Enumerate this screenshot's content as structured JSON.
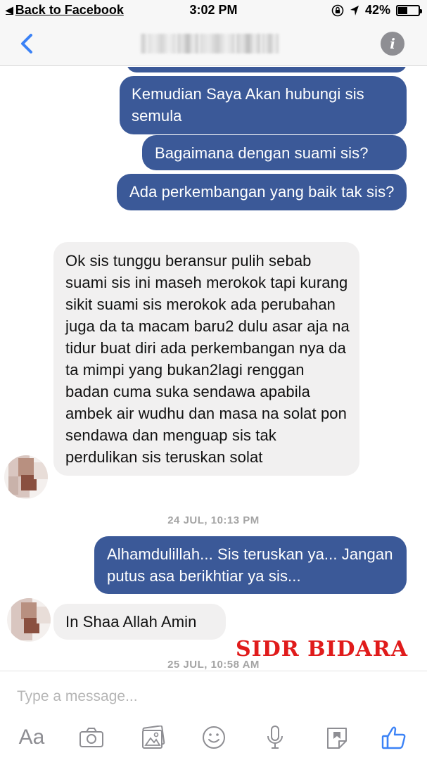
{
  "status_bar": {
    "back_label": "Back to Facebook",
    "time": "3:02 PM",
    "battery_text": "42%",
    "battery_level": 0.42
  },
  "nav": {
    "back_icon": "chevron-left-icon",
    "info_glyph": "i"
  },
  "conversation": {
    "outgoing": [
      "Kemudian Saya Akan hubungi sis semula",
      "Bagaimana dengan suami sis?",
      "Ada perkembangan yang baik tak sis?",
      "Alhamdulillah... Sis teruskan ya... Jangan putus asa berikhtiar ya sis..."
    ],
    "incoming": [
      "Ok sis tunggu beransur pulih sebab suami sis ini maseh merokok tapi kurang sikit suami sis merokok ada perubahan juga da ta macam baru2 dulu asar aja na tidur buat diri ada perkembangan nya da ta mimpi yang bukan2lagi renggan badan cuma suka sendawa apabila ambek air wudhu dan masa na solat pon sendawa dan menguap sis tak perdulikan sis teruskan solat",
      "In Shaa Allah Amin"
    ],
    "timestamps": [
      "24 JUL, 10:13 PM",
      "25 JUL, 10:58 AM"
    ]
  },
  "watermark": "SIDR BIDARA",
  "composer": {
    "placeholder": "Type a message...",
    "text_button": "Aa",
    "icons": [
      "camera-icon",
      "gallery-icon",
      "emoji-icon",
      "microphone-icon",
      "sticker-icon",
      "thumbs-up-icon"
    ]
  },
  "colors": {
    "outgoing_bubble": "#3b5998",
    "incoming_bubble": "#f1f0f0",
    "accent": "#3b82f6",
    "watermark": "#e01b1b",
    "timestamp": "#a4a4a4"
  }
}
